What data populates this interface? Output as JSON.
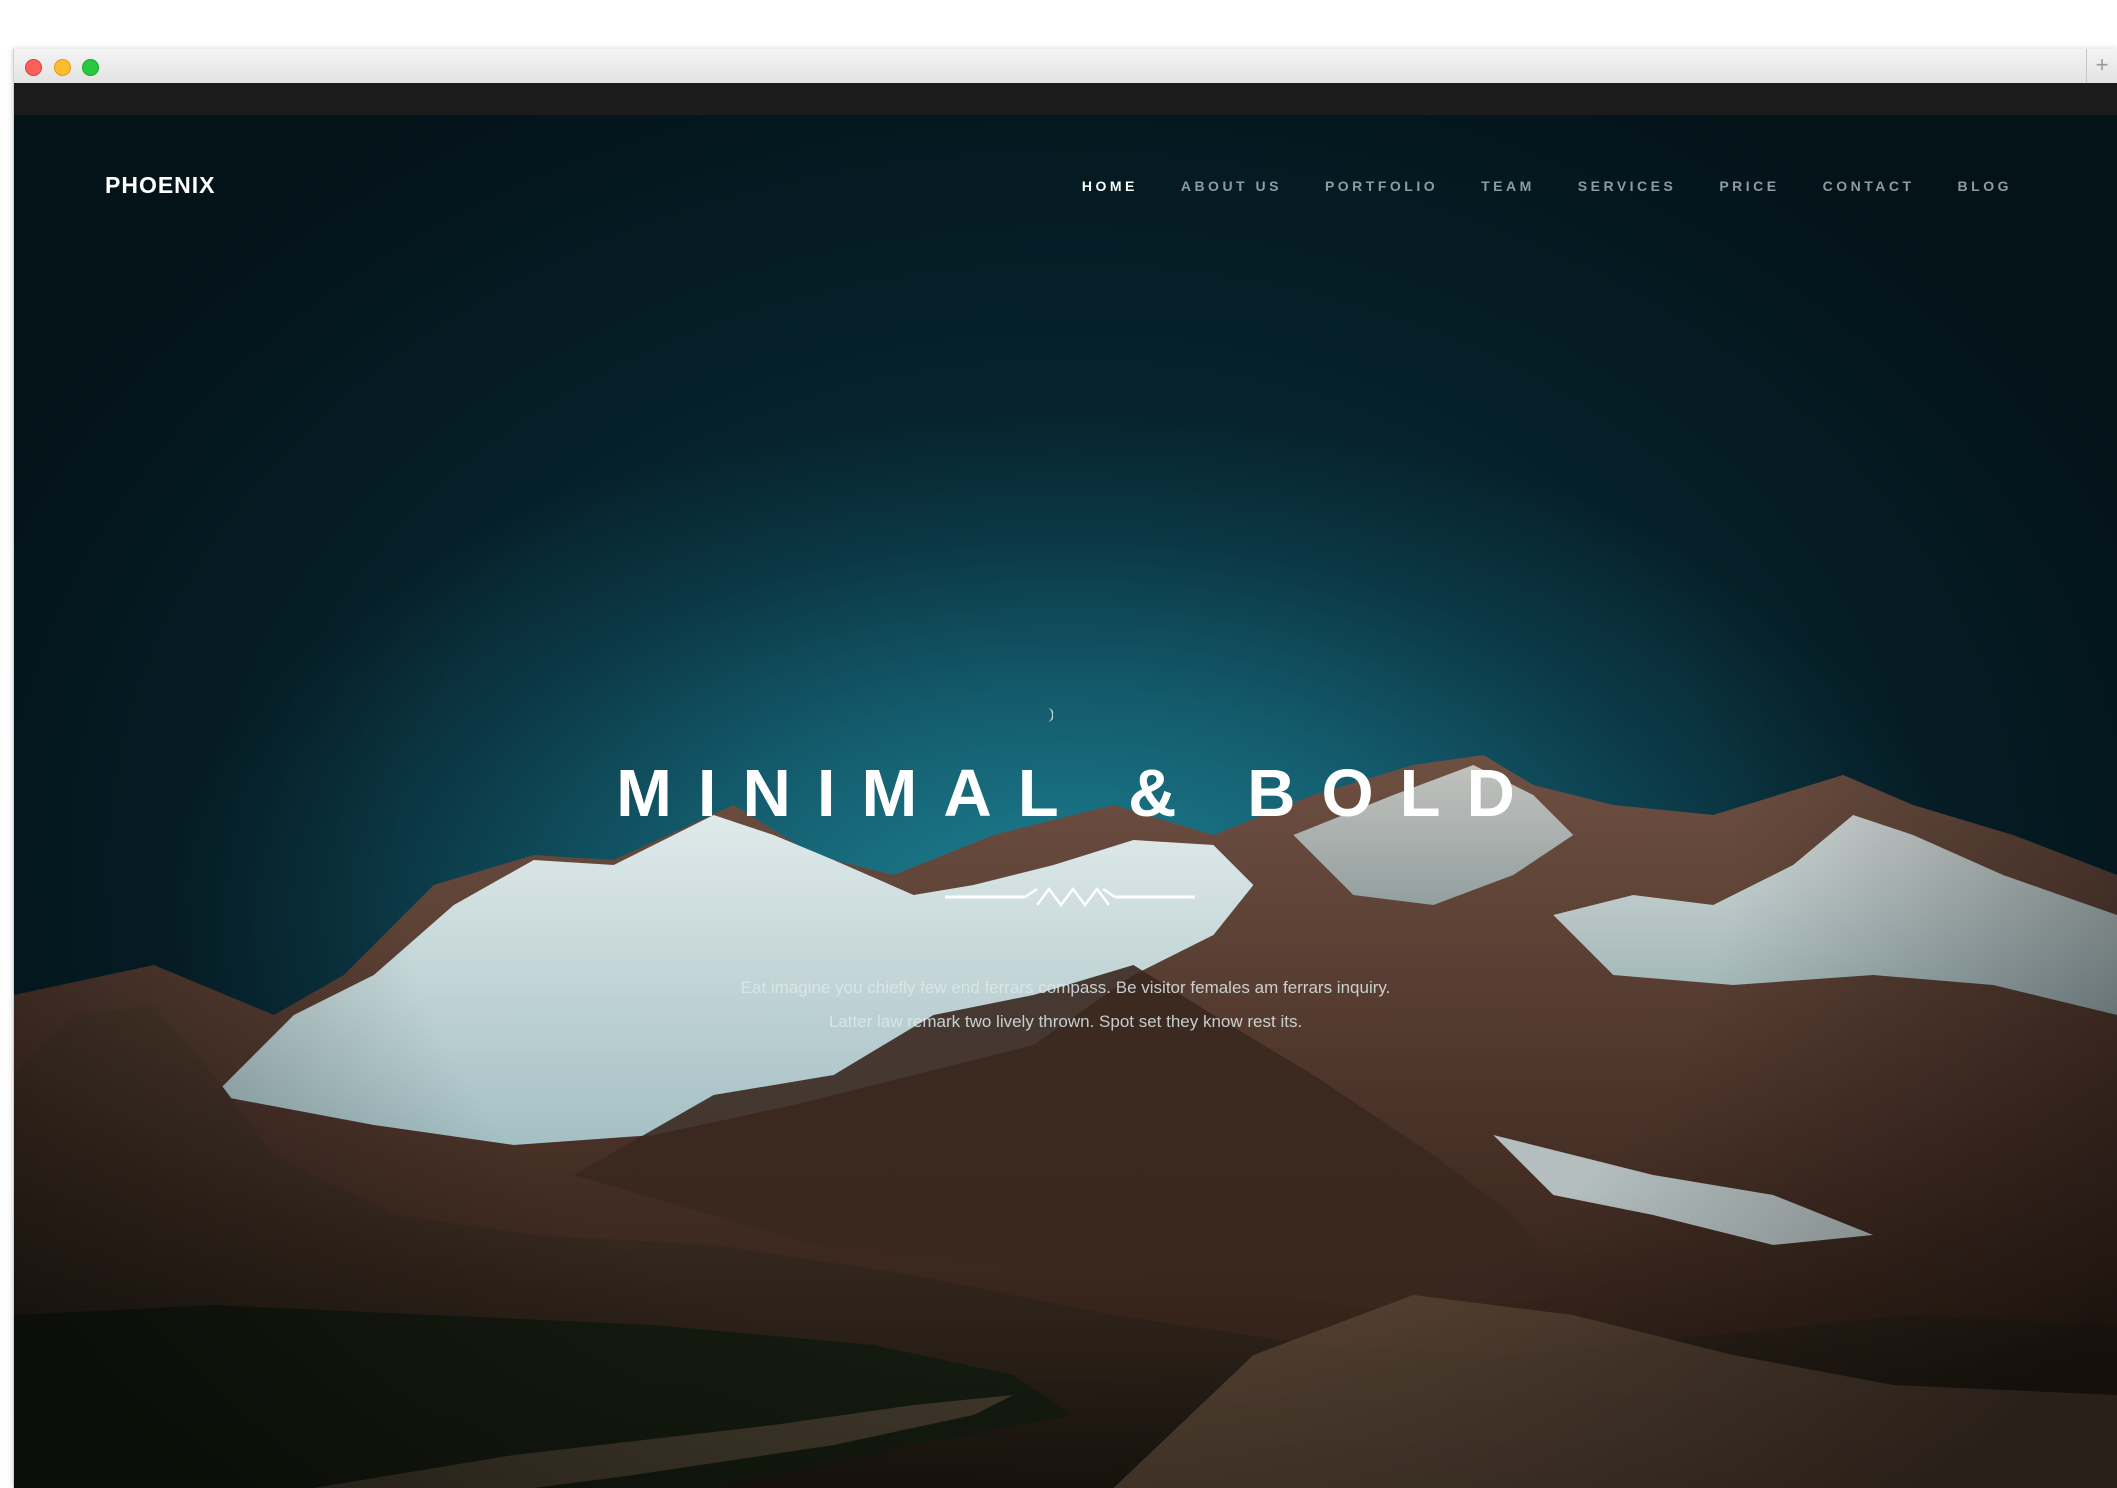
{
  "browser": {
    "controls": [
      "close",
      "minimize",
      "maximize"
    ],
    "new_tab_icon": "+"
  },
  "header": {
    "logo": "PHOENIX",
    "nav": [
      {
        "label": "HOME",
        "active": true
      },
      {
        "label": "ABOUT US",
        "active": false
      },
      {
        "label": "PORTFOLIO",
        "active": false
      },
      {
        "label": "TEAM",
        "active": false
      },
      {
        "label": "SERVICES",
        "active": false
      },
      {
        "label": "PRICE",
        "active": false
      },
      {
        "label": "CONTACT",
        "active": false
      },
      {
        "label": "BLOG",
        "active": false
      }
    ]
  },
  "hero": {
    "headline": "MINIMAL & BOLD",
    "subtext_line1": "Eat imagine you chiefly few end ferrars compass. Be visitor females am ferrars inquiry.",
    "subtext_line2": "Latter law remark two lively thrown. Spot set they know rest its.",
    "divider_icon": "ornament-divider-icon"
  },
  "colors": {
    "sky_center": "#1e8496",
    "sky_edge": "#06222c",
    "nav_active": "#ffffff",
    "nav_inactive": "#8a9da3"
  }
}
